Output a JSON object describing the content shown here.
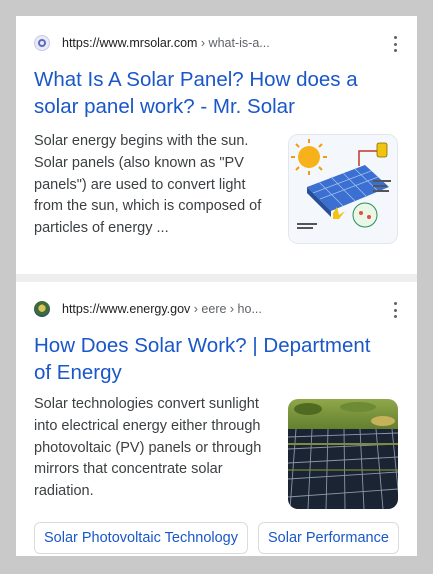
{
  "results": [
    {
      "domain": "https://www.mrsolar.com",
      "path": " › what-is-a...",
      "title": "What Is A Solar Panel? How does a solar panel work? - Mr. Solar",
      "snippet": "Solar energy begins with the sun. Solar panels (also known as \"PV panels\") are used to convert light from the sun, which is composed of particles of energy ..."
    },
    {
      "domain": "https://www.energy.gov",
      "path": " › eere › ho...",
      "title": "How Does Solar Work? | Department of Energy",
      "snippet": "Solar technologies convert sunlight into electrical energy either through photovoltaic (PV) panels or through mirrors that concentrate solar radiation.",
      "chips": [
        "Solar Photovoltaic Technology",
        "Solar Performance"
      ]
    }
  ],
  "colors": {
    "link": "#1a57c9",
    "text": "#3c4043",
    "page_bg": "#c9c9c9"
  }
}
